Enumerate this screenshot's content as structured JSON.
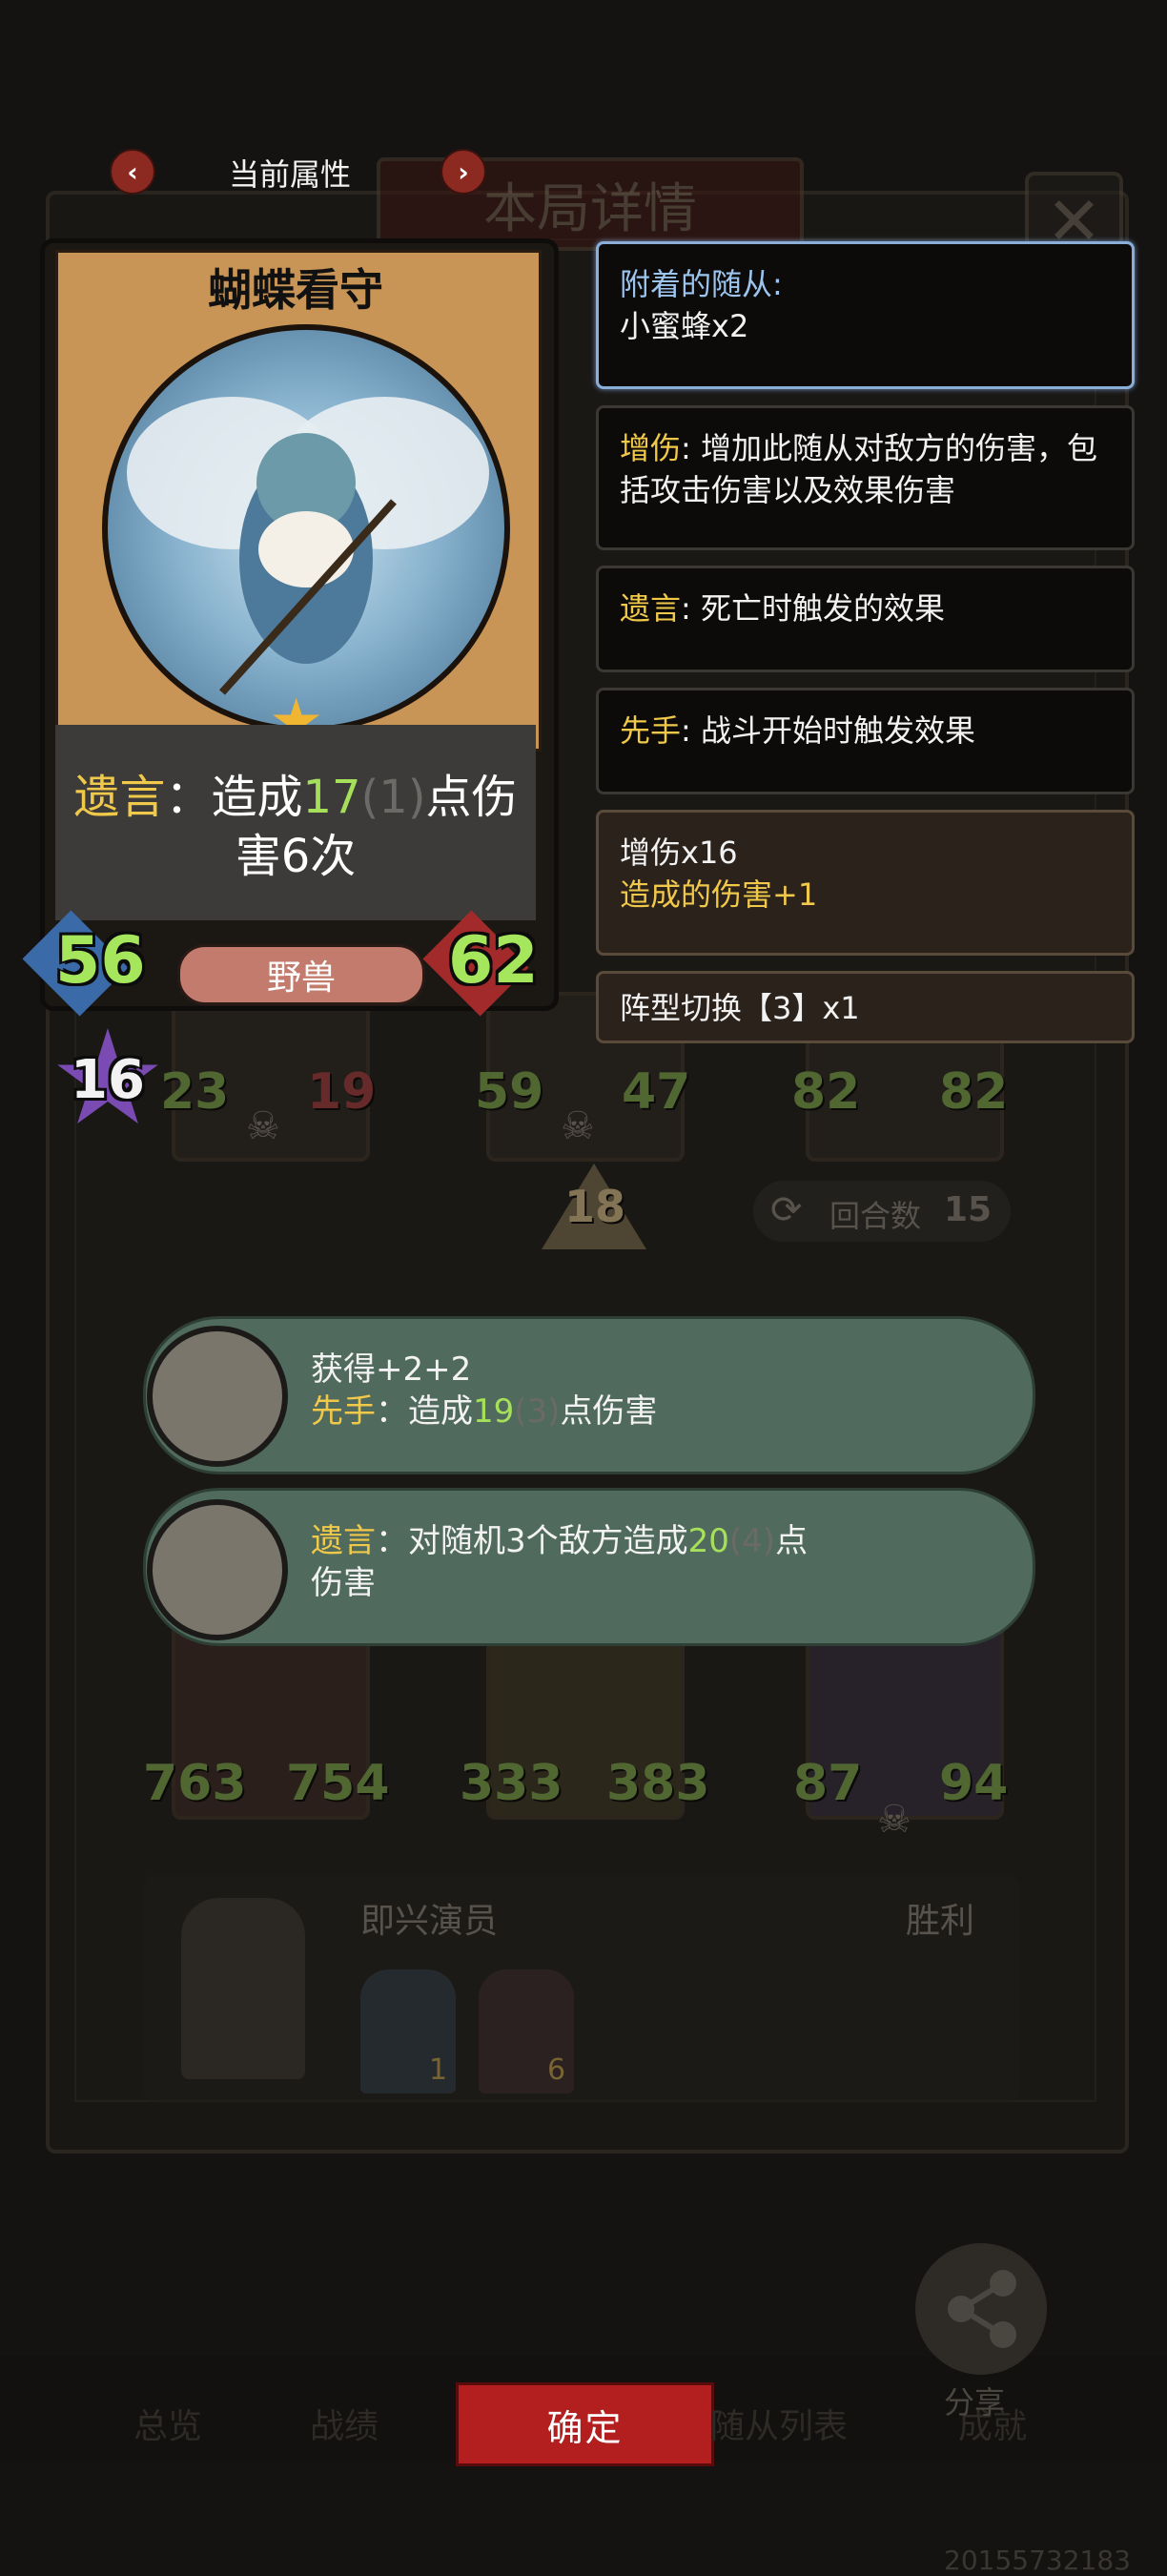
{
  "header": {
    "attr_label": "当前属性",
    "prev_arrow": "‹",
    "next_arrow": "›",
    "panel_title": "本局详情",
    "close_glyph": "✕"
  },
  "card": {
    "name": "蝴蝶看守",
    "ability_keyword": "遗言",
    "ability_colon": "：",
    "ability_pre": "造成",
    "ability_value": "17",
    "ability_bonus": "(1)",
    "ability_post": "点伤害6次",
    "attack": "56",
    "health": "62",
    "tribe": "野兽",
    "tier": "16"
  },
  "info": {
    "attached_label": "附着的随从:",
    "attached_value": "小蜜蜂x2",
    "buff_dmg_kw": "增伤",
    "buff_dmg_text": ": 增加此随从对敌方的伤害，包括攻击伤害以及效果伤害",
    "deathrattle_kw": "遗言",
    "deathrattle_text": ": 死亡时触发的效果",
    "first_kw": "先手",
    "first_text": ": 战斗开始时触发效果",
    "stack_title": "增伤x16",
    "stack_sub": "造成的伤害+1",
    "formation_title": "阵型切换【3】x1"
  },
  "board": {
    "row1": [
      {
        "atk": "23",
        "hp": "19"
      },
      {
        "atk": "59",
        "hp": "47"
      },
      {
        "atk": "82",
        "hp": "82"
      }
    ],
    "level": "18",
    "round_label": "回合数",
    "round_value": "15",
    "row2": [
      {
        "atk": "763",
        "hp": "754"
      },
      {
        "atk": "333",
        "hp": "383"
      },
      {
        "atk": "87",
        "hp": "94"
      }
    ]
  },
  "bubbles": [
    {
      "line1": "获得+2+2",
      "kw": "先手",
      "pre": "：造成",
      "value": "19",
      "bonus": "(3)",
      "post": "点伤害"
    },
    {
      "kw": "遗言",
      "pre": "：对随机3个敌方造成",
      "value": "20",
      "bonus": "(4)",
      "post": "点",
      "line2": "伤害"
    }
  ],
  "opponent": {
    "name": "即兴演员",
    "result": "胜利",
    "badge1": "1",
    "badge2": "6"
  },
  "bottom": {
    "tab1": "总览",
    "tab2": "战绩",
    "confirm": "确定",
    "tab4": "随从列表",
    "tab5": "成就",
    "share": "分享"
  },
  "uid": "20155732183",
  "colors": {
    "accent_red": "#b31f1f",
    "keyword_gold": "#f0c84a",
    "value_green": "#a6e05a",
    "attached_blue": "#9bc4ee"
  }
}
